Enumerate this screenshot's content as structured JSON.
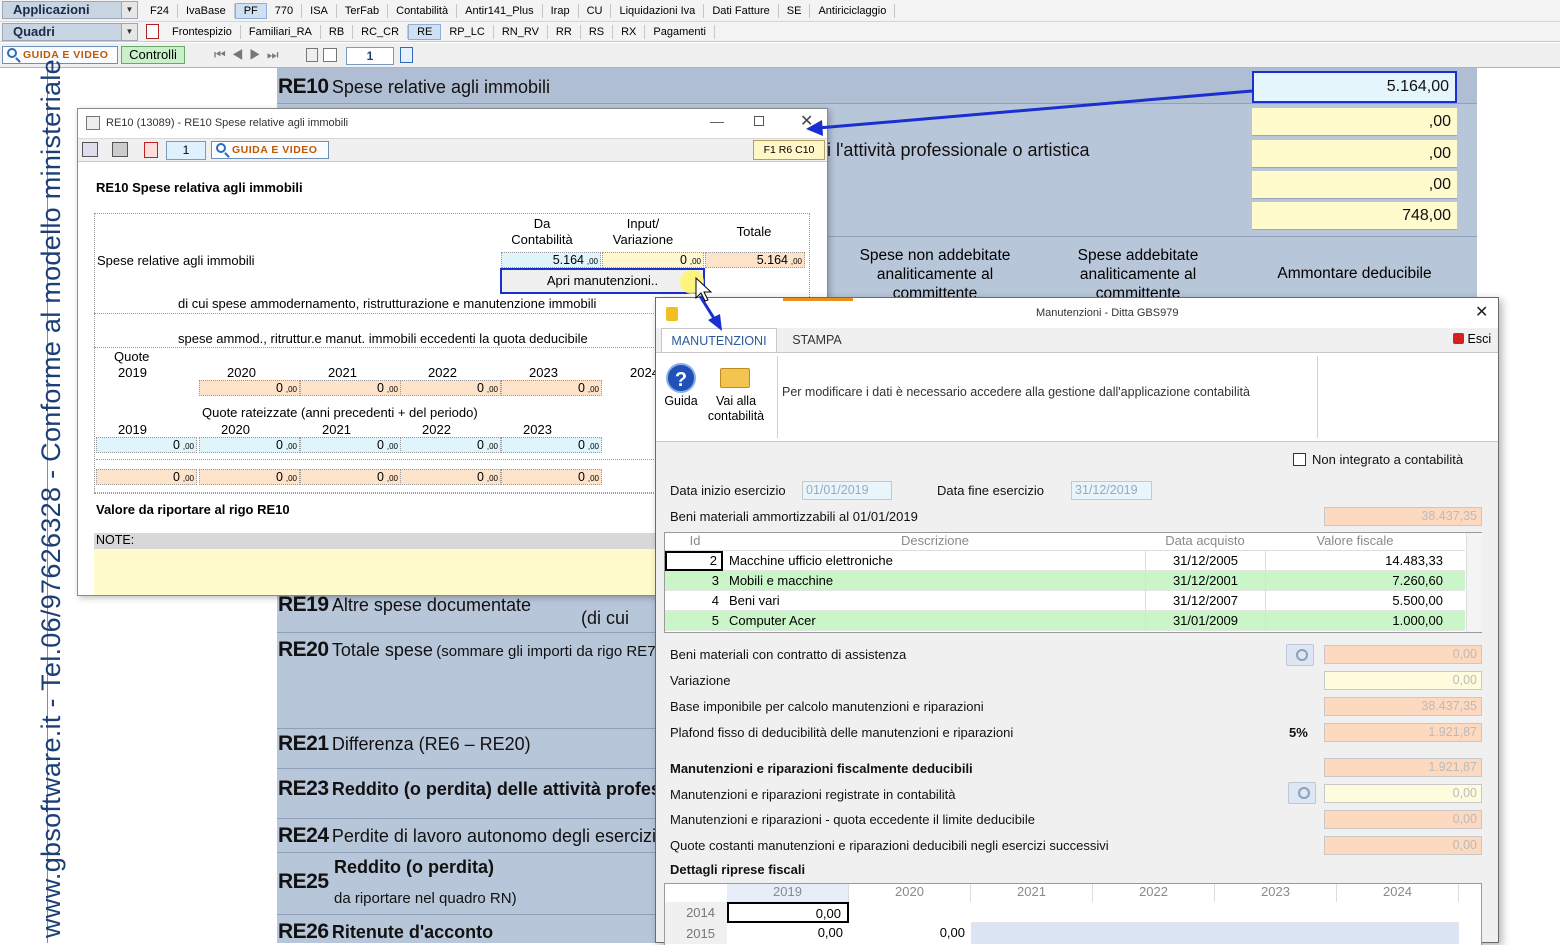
{
  "toolbar": {
    "applicazioni": "Applicazioni",
    "quadri": "Quadri",
    "apps": [
      "F24",
      "IvaBase",
      "PF",
      "770",
      "ISA",
      "TerFab",
      "Contabilità",
      "Antir141_Plus",
      "Irap",
      "CU",
      "Liquidazioni Iva",
      "Dati Fatture",
      "SE",
      "Antiriciclaggio"
    ],
    "selected_app": "PF",
    "quadri_tabs": [
      "Frontespizio",
      "Familiari_RA",
      "RB",
      "RC_CR",
      "RE",
      "RP_LC",
      "RN_RV",
      "RR",
      "RS",
      "RX",
      "Pagamenti"
    ],
    "selected_quadro": "RE",
    "guida_video": "GUIDA E VIDEO",
    "controlli": "Controlli",
    "page_num": "1"
  },
  "vertical_text": "www.gbsoftware.it - Tel.06/97626328 - Conforme al modello ministeriale",
  "background_form": {
    "re10_code": "RE10",
    "re10_label": "Spese relative agli immobili",
    "re10_value": "5.164,00",
    "line2_value": ",00",
    "line3_text": "ti l'attività professionale o artistica",
    "line3_value": ",00",
    "line4_value": ",00",
    "line5_value": "748,00",
    "col_spese_non_add": "Spese non addebitate analiticamente al committente",
    "col_spese_add": "Spese addebitate analiticamente al committente",
    "col_ammontare": "Ammontare deducibile",
    "re19_code": "RE19",
    "re19_label": "Altre spese documentate",
    "di_cui": "(di cui",
    "re20_code": "RE20",
    "re20_label": "Totale spese",
    "re20_sub": "(sommare gli importi da rigo RE7",
    "re21_code": "RE21",
    "re21_label": "Differenza (RE6 – RE20)",
    "re23_code": "RE23",
    "re23_label": "Reddito (o perdita) delle attività professi",
    "re24_code": "RE24",
    "re24_label": "Perdite di lavoro autonomo degli esercizi",
    "re25_code": "RE25",
    "re25_label": "Reddito (o perdita)",
    "re25_sub": "da riportare nel quadro RN)",
    "re26_code": "RE26",
    "re26_label": "Ritenute d'acconto"
  },
  "dialog1": {
    "title": "RE10 (13089) - RE10 Spese relative agli immobili",
    "page": "1",
    "guida_video": "GUIDA E VIDEO",
    "ref": "F1 R6 C10",
    "heading": "RE10  Spese relativa agli immobili",
    "col_da": "Da Contabilità",
    "col_input": "Input/ Variazione",
    "col_totale": "Totale",
    "row_label": "Spese relative agli immobili",
    "val_da": "5.164",
    "val_input": "0",
    "val_totale": "5.164",
    "dec": ",00",
    "apri_btn": "Apri manutenzioni..",
    "di_cui": "di cui spese ammodernamento, ristrutturazione e manutenzione immobili",
    "eccedenti": "spese ammod., ritruttur.e manut. immobili eccedenti la quota deducibile",
    "quote": "Quote",
    "years1": [
      "2019",
      "2020",
      "2021",
      "2022",
      "2023",
      "2024"
    ],
    "quote_rateizzate": "Quote rateizzate (anni precedenti + del periodo)",
    "years2": [
      "2019",
      "2020",
      "2021",
      "2022",
      "2023"
    ],
    "zero": "0",
    "valore_riportare": "Valore da riportare al rigo RE10",
    "note": "NOTE:"
  },
  "dialog2": {
    "title": "Manutenzioni - Ditta GBS979",
    "tab_manutenzioni": "MANUTENZIONI",
    "tab_stampa": "STAMPA",
    "esci": "Esci",
    "guida": "Guida",
    "vai_contabilita": "Vai alla contabilità",
    "info": "Per modificare i dati è necessario accedere alla gestione dall'applicazione contabilità",
    "non_integrato": "Non integrato a contabilità",
    "data_inizio_label": "Data inizio esercizio",
    "data_inizio": "01/01/2019",
    "data_fine_label": "Data fine esercizio",
    "data_fine": "31/12/2019",
    "beni_amm_label": "Beni materiali ammortizzabili al 01/01/2019",
    "beni_amm_value": "38.437,35",
    "grid_headers": [
      "Id",
      "Descrizione",
      "Data acquisto",
      "Valore fiscale"
    ],
    "beni": [
      {
        "id": "2",
        "descr": "Macchine ufficio elettroniche",
        "data": "31/12/2005",
        "valore": "14.483,33"
      },
      {
        "id": "3",
        "descr": "Mobili e macchine",
        "data": "31/12/2001",
        "valore": "7.260,60"
      },
      {
        "id": "4",
        "descr": "Beni vari",
        "data": "31/12/2007",
        "valore": "5.500,00"
      },
      {
        "id": "5",
        "descr": "Computer Acer",
        "data": "31/01/2009",
        "valore": "1.000,00"
      }
    ],
    "assistenza_label": "Beni materiali con contratto di assistenza",
    "assistenza_value": "0,00",
    "variazione_label": "Variazione",
    "variazione_value": "0,00",
    "base_label": "Base imponibile per calcolo manutenzioni e riparazioni",
    "base_value": "38.437,35",
    "plafond_label": "Plafond fisso di deducibilità delle manutenzioni e riparazioni",
    "plafond_pct": "5%",
    "plafond_value": "1.921,87",
    "deducibili_label": "Manutenzioni e riparazioni fiscalmente deducibili",
    "deducibili_value": "1.921,87",
    "registrate_label": "Manutenzioni e riparazioni registrate in contabilità",
    "registrate_value": "0,00",
    "eccedente_label": "Manutenzioni e riparazioni - quota eccedente il limite deducibile",
    "eccedente_value": "0,00",
    "quote_costanti_label": "Quote costanti manutenzioni e riparazioni deducibili negli esercizi successivi",
    "quote_costanti_value": "0,00",
    "dettagli_label": "Dettagli riprese fiscali",
    "riprese_years": [
      "2019",
      "2020",
      "2021",
      "2022",
      "2023",
      "2024"
    ],
    "riprese_rows": [
      {
        "year": "2014",
        "v2019": "0,00",
        "v2020": ""
      },
      {
        "year": "2015",
        "v2019": "0,00",
        "v2020": "0,00"
      }
    ]
  }
}
